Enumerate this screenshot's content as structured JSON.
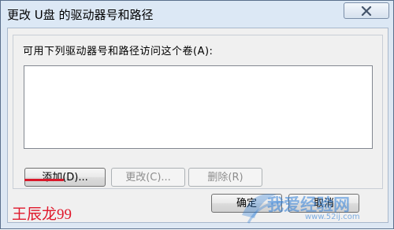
{
  "window": {
    "title": "更改 U盘 的驱动器号和路径"
  },
  "group": {
    "label": "可用下列驱动器号和路径访问这个卷(A):",
    "items": []
  },
  "buttons": {
    "add": "添加(D)...",
    "change": "更改(C)...",
    "remove": "删除(R)",
    "ok": "确定",
    "cancel": "取消"
  },
  "overlay": {
    "signature": "王辰龙99",
    "watermark_text": "我爱经验网",
    "watermark_url": "www.52ij.com"
  },
  "colors": {
    "highlight_underline": "#d9182a",
    "signature": "#e0182b",
    "watermark": "#2f7fd8"
  }
}
